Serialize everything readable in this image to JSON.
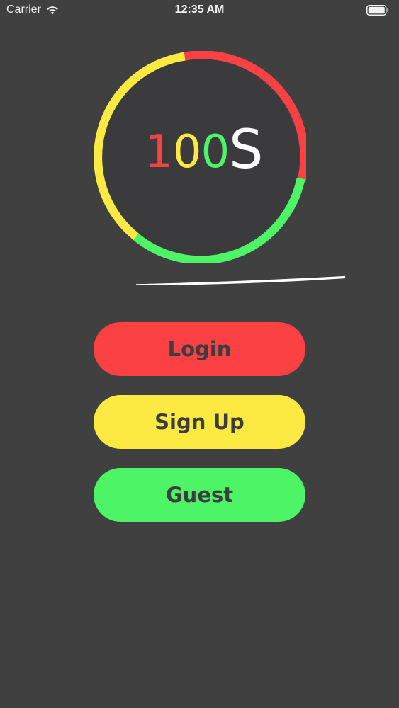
{
  "status_bar": {
    "carrier": "Carrier",
    "time": "12:35 AM",
    "wifi_icon": "wifi-icon",
    "battery_icon": "battery-icon"
  },
  "logo": {
    "digit_1": "1",
    "digit_2": "0",
    "digit_3": "0",
    "letter": "S",
    "colors": {
      "red": "#fb4143",
      "yellow": "#fcea42",
      "green": "#4cf466",
      "white": "#ffffff",
      "inner": "#3b3a3c"
    }
  },
  "buttons": {
    "login": "Login",
    "sign_up": "Sign Up",
    "guest": "Guest"
  },
  "colors": {
    "background": "#404041",
    "button_text": "#3d3d3f"
  }
}
